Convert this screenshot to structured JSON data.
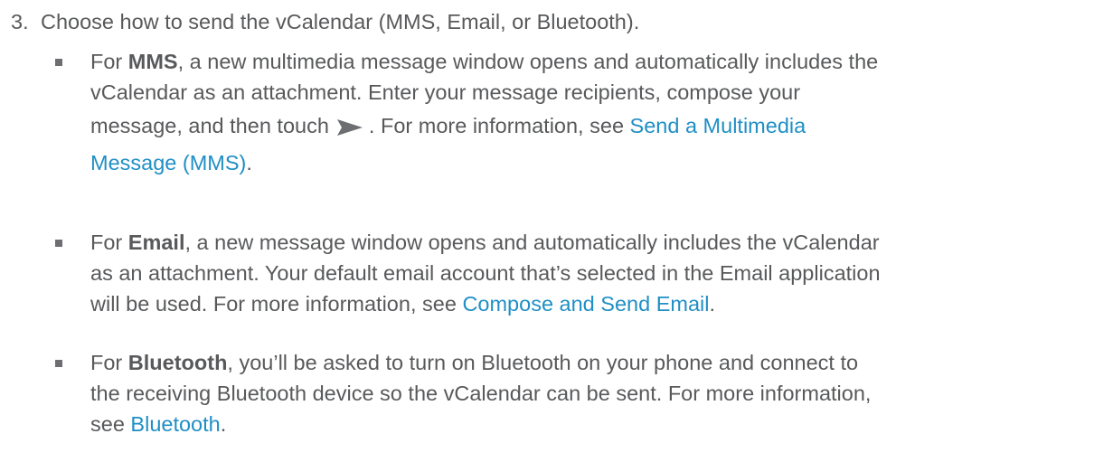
{
  "step": {
    "number": "3.",
    "text": "Choose how to send the vCalendar (MMS, Email, or Bluetooth)."
  },
  "mms": {
    "prefix": "For ",
    "label": "MMS",
    "line1_rest": ", a new multimedia message window opens and automatically includes the",
    "line2": "vCalendar as an attachment. Enter your message recipients, compose your",
    "line3_before_icon": "message, and then touch",
    "line3_after_icon": ". For more information, see ",
    "link_part1": "Send a Multimedia",
    "link_part2": "Message (MMS)",
    "end": ".",
    "icon": "send-icon"
  },
  "email": {
    "prefix": "For ",
    "label": "Email",
    "line1_rest": ", a new message window opens and automatically includes the vCalendar",
    "line2": "as an attachment. Your default email account that’s selected in the Email application",
    "line3": "will be used. For more information, see ",
    "link": "Compose and Send Email",
    "end": "."
  },
  "bluetooth": {
    "prefix": "For ",
    "label": "Bluetooth",
    "line1_rest": ", you’ll be asked to turn on Bluetooth on your phone and connect to",
    "line2": "the receiving Bluetooth device so the vCalendar can be sent. For more information,",
    "line3": "see ",
    "link": "Bluetooth",
    "end": "."
  },
  "colors": {
    "text": "#58595b",
    "link": "#1f8fc5",
    "bullet": "#6d6e71"
  }
}
